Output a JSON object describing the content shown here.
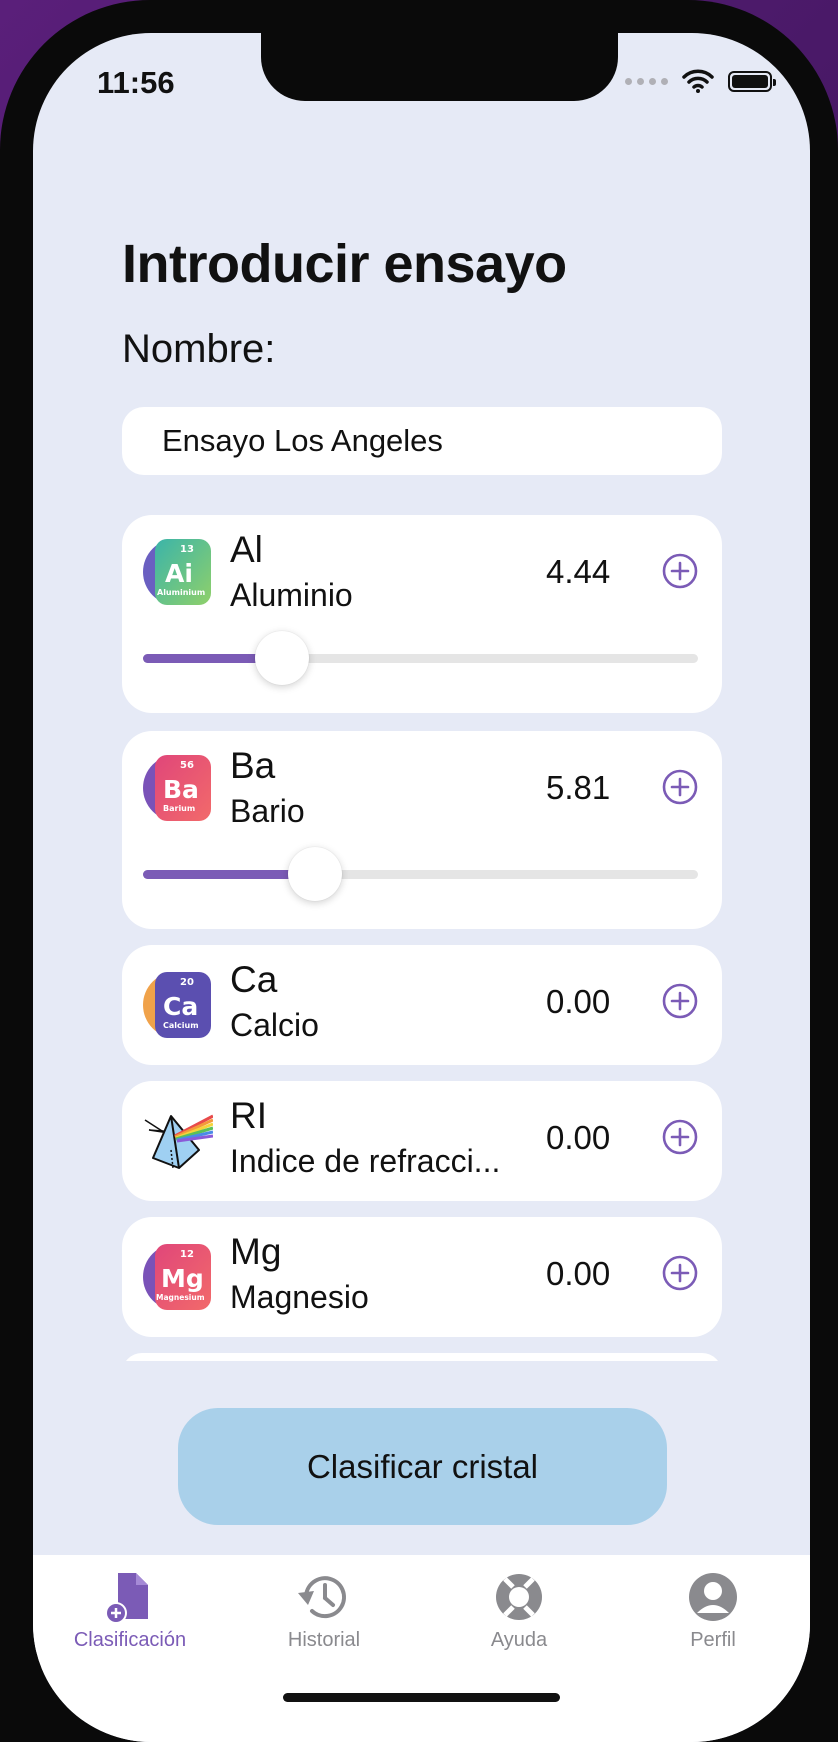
{
  "status": {
    "time": "11:56"
  },
  "title": "Introducir ensayo",
  "name_label": "Nombre:",
  "name_value": "Ensayo Los Angeles",
  "elements": [
    {
      "symbol": "Al",
      "name": "Aluminio",
      "value": "4.44",
      "icon_text": "Ai",
      "icon_number": "13",
      "icon_caption": "Aluminium",
      "slider_fraction": 0.25
    },
    {
      "symbol": "Ba",
      "name": "Bario",
      "value": "5.81",
      "icon_text": "Ba",
      "icon_number": "56",
      "icon_caption": "Barium",
      "slider_fraction": 0.31
    },
    {
      "symbol": "Ca",
      "name": "Calcio",
      "value": "0.00",
      "icon_text": "Ca",
      "icon_number": "20",
      "icon_caption": "Calcium"
    },
    {
      "symbol": "RI",
      "name": "Indice de refracci...",
      "value": "0.00"
    },
    {
      "symbol": "Mg",
      "name": "Magnesio",
      "value": "0.00",
      "icon_text": "Mg",
      "icon_number": "12",
      "icon_caption": "Magnesium"
    }
  ],
  "action_button": "Clasificar cristal",
  "tabs": [
    {
      "label": "Clasificación",
      "icon": "document-plus-icon",
      "active": true
    },
    {
      "label": "Historial",
      "icon": "history-icon",
      "active": false
    },
    {
      "label": "Ayuda",
      "icon": "lifebuoy-icon",
      "active": false
    },
    {
      "label": "Perfil",
      "icon": "person-circle-icon",
      "active": false
    }
  ],
  "colors": {
    "accent": "#7b5bb6",
    "background": "#e6eaf6",
    "button": "#a9d0ea",
    "inactive": "#8a8a8e"
  }
}
